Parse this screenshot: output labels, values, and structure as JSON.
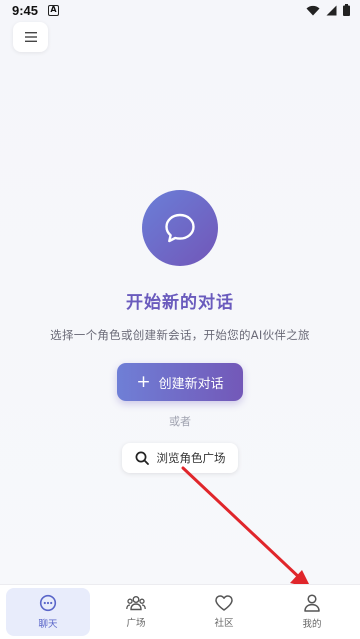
{
  "status_bar": {
    "time": "9:45",
    "app_icon_letter": "A"
  },
  "menu": {
    "icon": "hamburger-menu-icon"
  },
  "hero": {
    "icon": "chat-bubble-icon",
    "title": "开始新的对话",
    "subtitle": "选择一个角色或创建新会话，开始您的AI伙伴之旅",
    "create_button_label": "创建新对话",
    "or_text": "或者",
    "browse_button_label": "浏览角色广场"
  },
  "colors": {
    "accent_start": "#6f7fd6",
    "accent_end": "#7358b8",
    "title_color": "#6a5bbd",
    "arrow_color": "#e0262b"
  },
  "tabs": [
    {
      "label": "聊天",
      "icon": "chat-icon",
      "active": true
    },
    {
      "label": "广场",
      "icon": "people-icon",
      "active": false
    },
    {
      "label": "社区",
      "icon": "heart-icon",
      "active": false
    },
    {
      "label": "我的",
      "icon": "user-icon",
      "active": false
    }
  ]
}
